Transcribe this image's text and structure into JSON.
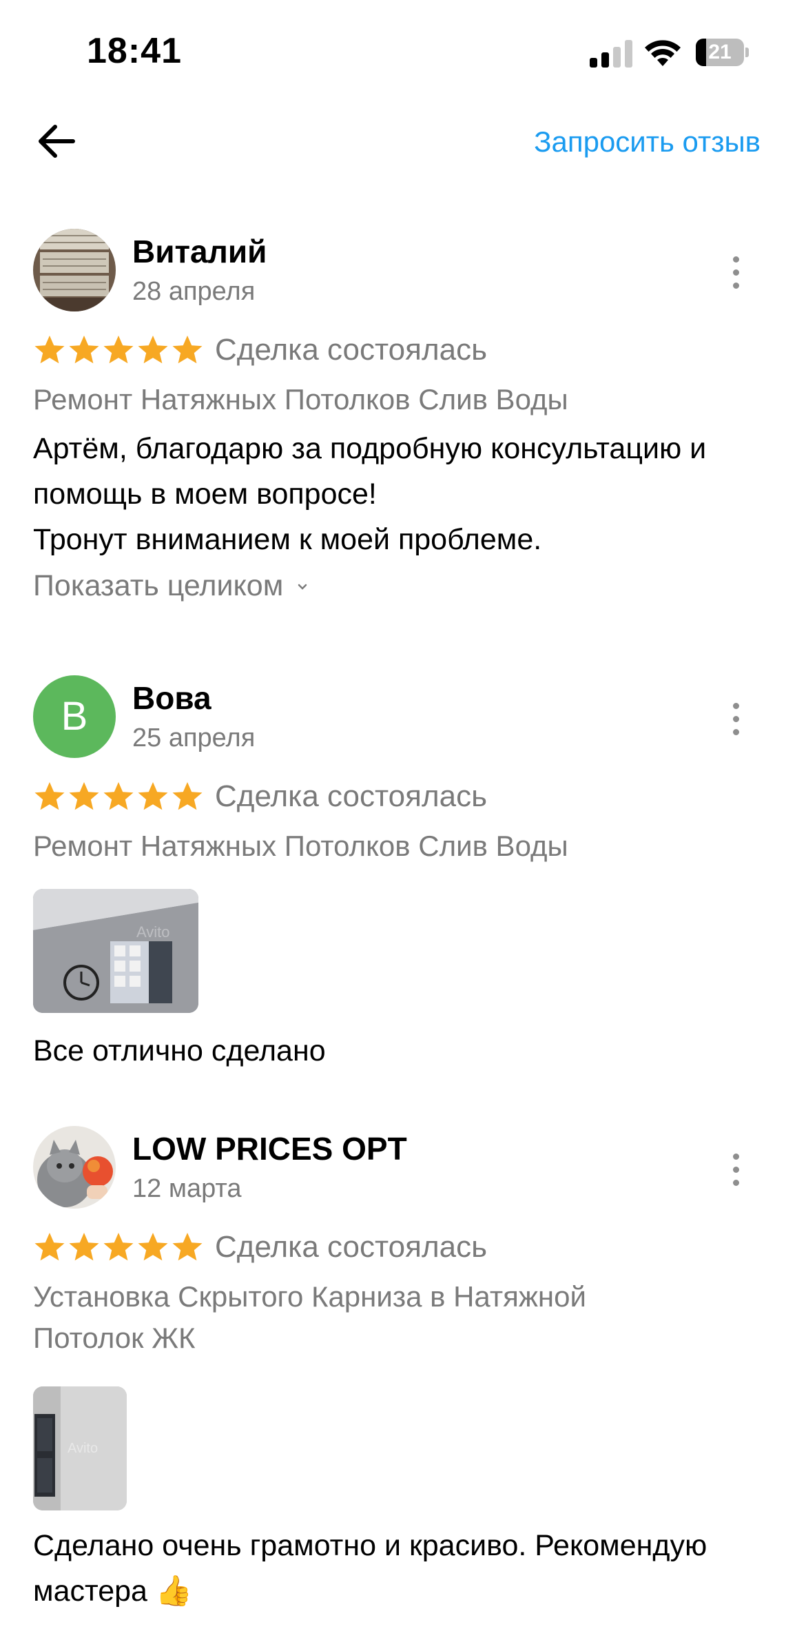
{
  "status_bar": {
    "time": "18:41",
    "battery_level": "21",
    "battery_fraction": 0.21,
    "signal_bars_active": 2,
    "signal_bars_total": 4
  },
  "nav": {
    "back_icon": "arrow-left-icon",
    "request_review_label": "Запросить отзыв",
    "accent_color": "#1a9bf0"
  },
  "reviews": [
    {
      "author": "Виталий",
      "date": "28 апреля",
      "rating": 5,
      "deal_status": "Сделка состоялась",
      "service": "Ремонт Натяжных Потолков Слив Воды",
      "text_lines": [
        "Артём, благодарю за подробную консультацию и",
        "помощь в моем вопросе!",
        "Тронут вниманием к моей проблеме."
      ],
      "show_full_label": "Показать целиком",
      "avatar_type": "photo"
    },
    {
      "author": "Вова",
      "avatar_letter": "В",
      "avatar_color": "#5cb85c",
      "date": "25 апреля",
      "rating": 5,
      "deal_status": "Сделка состоялась",
      "service": "Ремонт Натяжных Потолков Слив Воды",
      "text": "Все отлично сделано",
      "photo_watermark": "Avito"
    },
    {
      "author": "LOW PRICES OPT",
      "date": "12 марта",
      "rating": 5,
      "deal_status": "Сделка состоялась",
      "service_lines": [
        "Установка Скрытого Карниза в Натяжной",
        "Потолок ЖК"
      ],
      "text_lines": [
        "Сделано очень грамотно и красиво. Рекомендую",
        "мастера 👍"
      ],
      "photo_watermark": "Avito",
      "avatar_type": "photo"
    }
  ],
  "colors": {
    "star": "#f7a823",
    "secondary_text": "#7a7a7a"
  }
}
